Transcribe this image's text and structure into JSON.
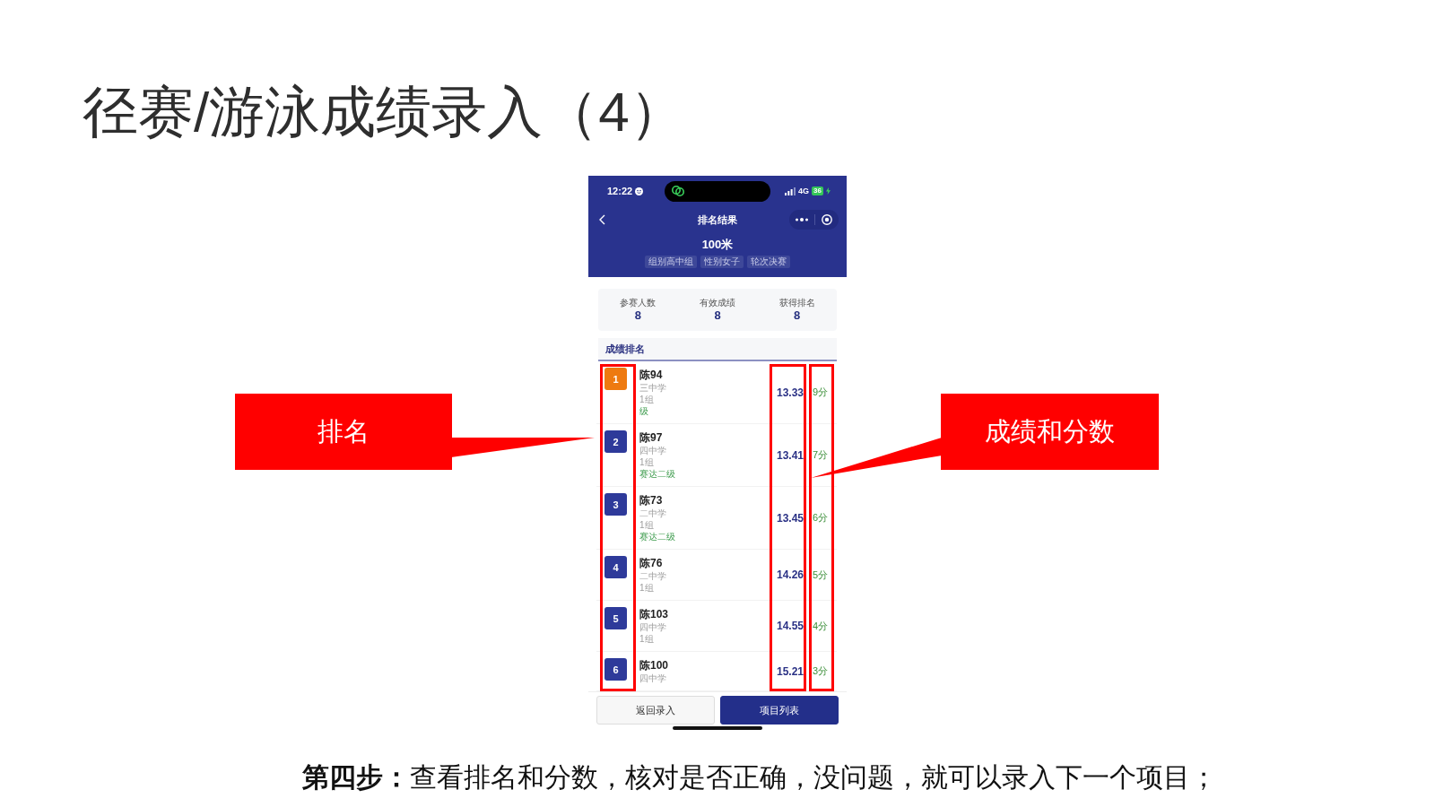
{
  "slide_title": "径赛/游泳成绩录入（4）",
  "phone": {
    "status_bar": {
      "time": "12:22",
      "network": "4G",
      "battery": "36"
    },
    "nav_bar": {
      "title": "排名结果"
    },
    "event": {
      "name": "100米",
      "tags": [
        "组别高中组",
        "性别女子",
        "轮次决赛"
      ]
    },
    "stats": [
      {
        "label": "参赛人数",
        "value": "8"
      },
      {
        "label": "有效成绩",
        "value": "8"
      },
      {
        "label": "获得排名",
        "value": "8"
      }
    ],
    "section_title": "成绩排名",
    "rows": [
      {
        "rank": "1",
        "color": "#ee7a10",
        "name": "陈94",
        "lines": [
          {
            "kind": "info",
            "text": "三中学"
          },
          {
            "kind": "info",
            "text": "1组"
          },
          {
            "kind": "level",
            "text": "级"
          }
        ],
        "time": "13.33",
        "points": "9分"
      },
      {
        "rank": "2",
        "color": "#2e3a9a",
        "name": "陈97",
        "lines": [
          {
            "kind": "info",
            "text": "四中学"
          },
          {
            "kind": "info",
            "text": "1组"
          },
          {
            "kind": "level",
            "text": "赛达二级"
          }
        ],
        "time": "13.41",
        "points": "7分"
      },
      {
        "rank": "3",
        "color": "#2e3a9a",
        "name": "陈73",
        "lines": [
          {
            "kind": "info",
            "text": "二中学"
          },
          {
            "kind": "info",
            "text": "1组"
          },
          {
            "kind": "level",
            "text": "赛达二级"
          }
        ],
        "time": "13.45",
        "points": "6分"
      },
      {
        "rank": "4",
        "color": "#2e3a9a",
        "name": "陈76",
        "lines": [
          {
            "kind": "info",
            "text": "二中学"
          },
          {
            "kind": "info",
            "text": "1组"
          }
        ],
        "time": "14.26",
        "points": "5分"
      },
      {
        "rank": "5",
        "color": "#2e3a9a",
        "name": "陈103",
        "lines": [
          {
            "kind": "info",
            "text": "四中学"
          },
          {
            "kind": "info",
            "text": "1组"
          }
        ],
        "time": "14.55",
        "points": "4分"
      },
      {
        "rank": "6",
        "color": "#2e3a9a",
        "name": "陈100",
        "lines": [
          {
            "kind": "info",
            "text": "四中学"
          }
        ],
        "time": "15.21",
        "points": "3分"
      }
    ],
    "buttons": [
      {
        "label": "返回录入",
        "kind": "secondary"
      },
      {
        "label": "项目列表",
        "kind": "primary"
      }
    ]
  },
  "annotations": [
    {
      "label": "排名",
      "kind": "left"
    },
    {
      "label": "成绩和分数",
      "kind": "right"
    }
  ],
  "caption": "**第四步：**查看排名和分数，核对是否正确，没问题，就可以录入下一个项目；"
}
